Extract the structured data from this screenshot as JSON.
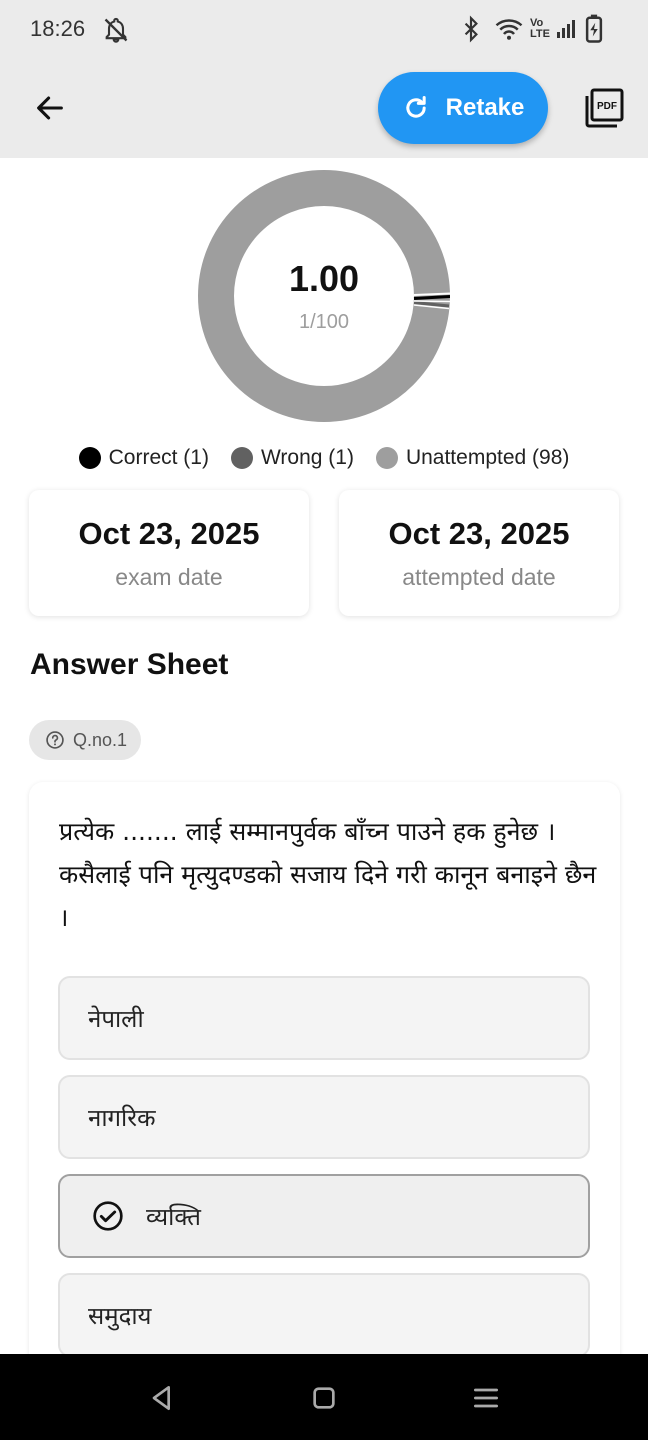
{
  "status_bar": {
    "time": "18:26",
    "icons": [
      "bell-off-icon",
      "bluetooth-icon",
      "wifi-icon",
      "volte-icon",
      "signal-icon",
      "battery-charging-icon"
    ]
  },
  "app_bar": {
    "back_icon": "arrow-left-icon",
    "retake_label": "Retake",
    "retake_icon": "refresh-icon",
    "pdf_icon": "pdf-icon",
    "pdf_icon_text": "PDF",
    "accent_color": "#2196f3"
  },
  "score": {
    "value": "1.00",
    "fraction": "1/100",
    "correct": 1,
    "wrong": 1,
    "unattempted": 98
  },
  "legend": [
    {
      "label": "Correct (1)",
      "color": "#000000"
    },
    {
      "label": "Wrong (1)",
      "color": "#616161"
    },
    {
      "label": "Unattempted (98)",
      "color": "#9e9e9e"
    }
  ],
  "dates": {
    "exam_date": "Oct 23, 2025",
    "exam_label": "exam date",
    "attempted_date": "Oct 23, 2025",
    "attempted_label": "attempted date"
  },
  "answer_sheet": {
    "title": "Answer Sheet",
    "question_number": "Q.no.1",
    "question_icon": "question-circle-icon",
    "question_text": "प्रत्येक ....... लाई सम्मानपुर्वक बाँच्न पाउने हक हुनेछ । कसैलाई पनि मृत्युदण्डको सजाय दिने गरी कानून बनाइने छैन ।",
    "options": [
      {
        "label": "नेपाली",
        "selected": false
      },
      {
        "label": "नागरिक",
        "selected": false
      },
      {
        "label": "व्यक्ति",
        "selected": true
      },
      {
        "label": "समुदाय",
        "selected": false
      }
    ],
    "selected_icon": "check-circle-icon"
  },
  "nav_bar": {
    "buttons": [
      "back-triangle-icon",
      "home-square-icon",
      "menu-lines-icon"
    ]
  }
}
